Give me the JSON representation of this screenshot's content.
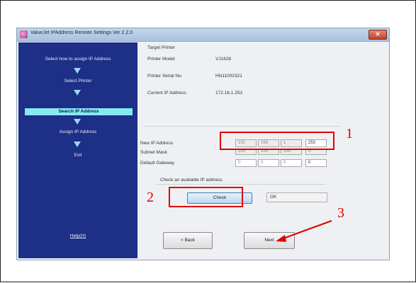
{
  "window": {
    "title": "ValueJet IPAddress Remote Settings   Ver 2.2.0",
    "close_glyph": "✕"
  },
  "sidebar": {
    "heading": "Select how to assign IP Address",
    "steps": [
      {
        "label": "Select Printer",
        "active": false
      },
      {
        "label": "Search IP Address",
        "active": true
      },
      {
        "label": "Assign IP Address",
        "active": false
      },
      {
        "label": "Exit",
        "active": false
      }
    ],
    "help": "Help(H)"
  },
  "target": {
    "heading": "Target Printer",
    "model_label": "Printer Model",
    "model_value": "VJ1628",
    "serial_label": "Printer Serial No.",
    "serial_value": "HN11002321",
    "current_ip_label": "Current IP Address",
    "current_ip_value": "172.16.1.253"
  },
  "network": {
    "new_ip_label": "New IP Address",
    "new_ip": [
      "192",
      "168",
      "1",
      "253"
    ],
    "subnet_label": "Subnet Mask",
    "subnet": [
      "255",
      "255",
      "255",
      "0"
    ],
    "gateway_label": "Default Gateway",
    "gateway": [
      "0",
      "0",
      "0",
      "0"
    ]
  },
  "check": {
    "heading": "Check an available IP address",
    "button": "Check",
    "result": "OK"
  },
  "nav": {
    "back": "< Back",
    "next": "Next"
  },
  "annotations": {
    "callout_1": "1",
    "callout_2": "2",
    "callout_3": "3",
    "color": "#e00000"
  }
}
